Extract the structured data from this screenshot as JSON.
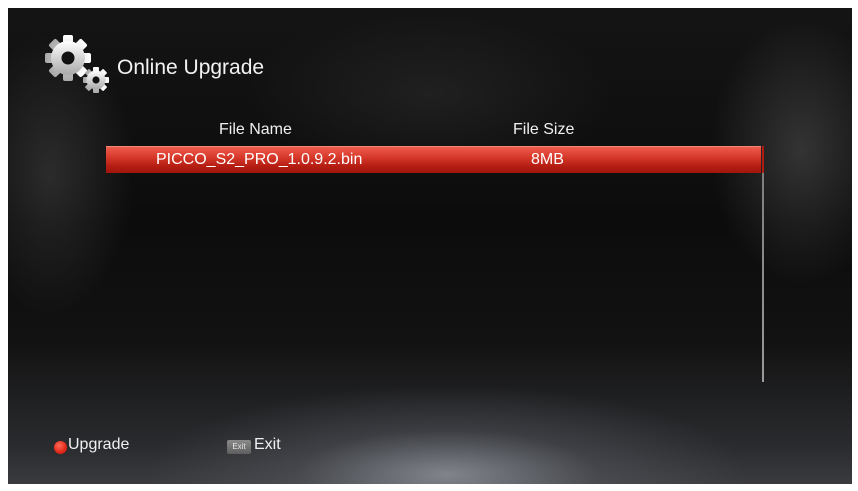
{
  "header": {
    "title": "Online Upgrade",
    "icon": "gears-icon"
  },
  "table": {
    "columns": [
      "File Name",
      "File Size"
    ],
    "rows": [
      {
        "file_name": "PICCO_S2_PRO_1.0.9.2.bin",
        "file_size": "8MB"
      }
    ],
    "selected_row": 0
  },
  "footer": {
    "upgrade_label": "Upgrade",
    "exit_key_label": "Exit",
    "exit_label": "Exit"
  },
  "colors": {
    "highlight": "#d83a2c",
    "red_key": "#e2261a",
    "text": "#f0f0f0"
  }
}
